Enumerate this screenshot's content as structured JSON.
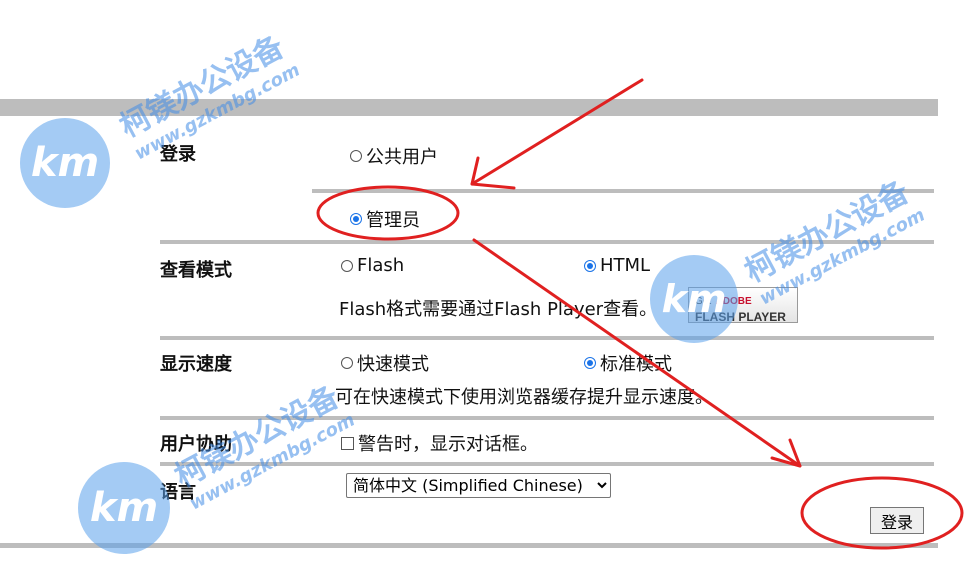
{
  "login": {
    "label": "登录",
    "options": [
      "公共用户",
      "管理员"
    ],
    "selected": "管理员"
  },
  "view_mode": {
    "label": "查看模式",
    "options": [
      "Flash",
      "HTML"
    ],
    "selected": "HTML",
    "note": "Flash格式需要通过Flash Player查看。",
    "flash_badge": {
      "get": "Get",
      "adobe": "ADOBE",
      "player": "FLASH PLAYER"
    }
  },
  "display_speed": {
    "label": "显示速度",
    "options": [
      "快速模式",
      "标准模式"
    ],
    "selected": "标准模式",
    "note": "可在快速模式下使用浏览器缓存提升显示速度。"
  },
  "user_assist": {
    "label": "用户协助",
    "checkbox_label": "警告时，显示对话框。",
    "checked": false
  },
  "language": {
    "label": "语言",
    "selected": "简体中文 (Simplified Chinese)"
  },
  "submit": {
    "label": "登录"
  },
  "watermark": {
    "cn": "柯镁办公设备",
    "url": "www.gzkmbg.com",
    "logo": "km"
  },
  "colors": {
    "annotation": "#e02020",
    "accent": "#1a73e8",
    "divider": "#bdbdbd"
  }
}
